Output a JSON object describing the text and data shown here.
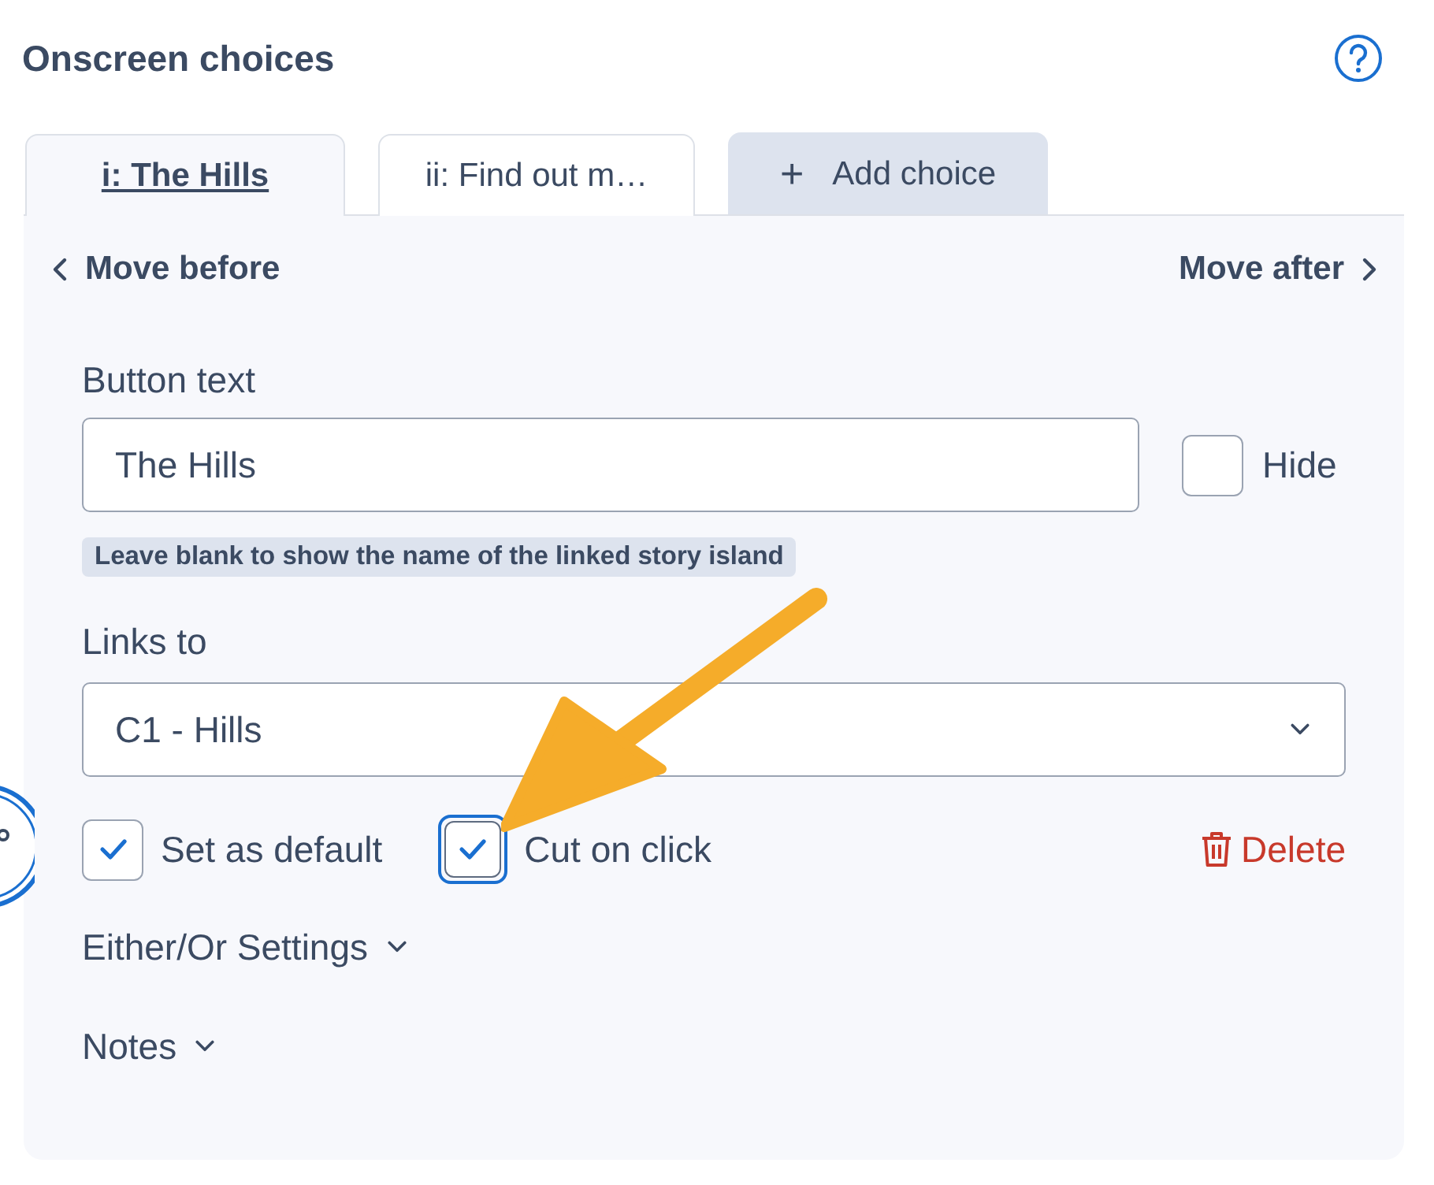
{
  "title": "Onscreen choices",
  "tabs": [
    {
      "label": "i: The Hills",
      "selected": true,
      "kind": "choice"
    },
    {
      "label": "ii: Find out m…",
      "selected": false,
      "kind": "choice"
    },
    {
      "label": "Add choice",
      "icon": "+",
      "selected": false,
      "kind": "add"
    }
  ],
  "nav": {
    "before": "Move before",
    "after": "Move after"
  },
  "button_text": {
    "label": "Button text",
    "value": "The Hills",
    "hide": {
      "label": "Hide",
      "checked": false
    },
    "hint": "Leave blank to show the name of the linked story island"
  },
  "links_to": {
    "label": "Links to",
    "value": "C1 - Hills"
  },
  "options": [
    {
      "label": "Set as default",
      "checked": true,
      "focused": false
    },
    {
      "label": "Cut on click",
      "checked": true,
      "focused": true
    }
  ],
  "delete": "Delete",
  "sections": [
    {
      "label": "Either/Or Settings",
      "expanded": false
    },
    {
      "label": "Notes",
      "expanded": false
    }
  ]
}
